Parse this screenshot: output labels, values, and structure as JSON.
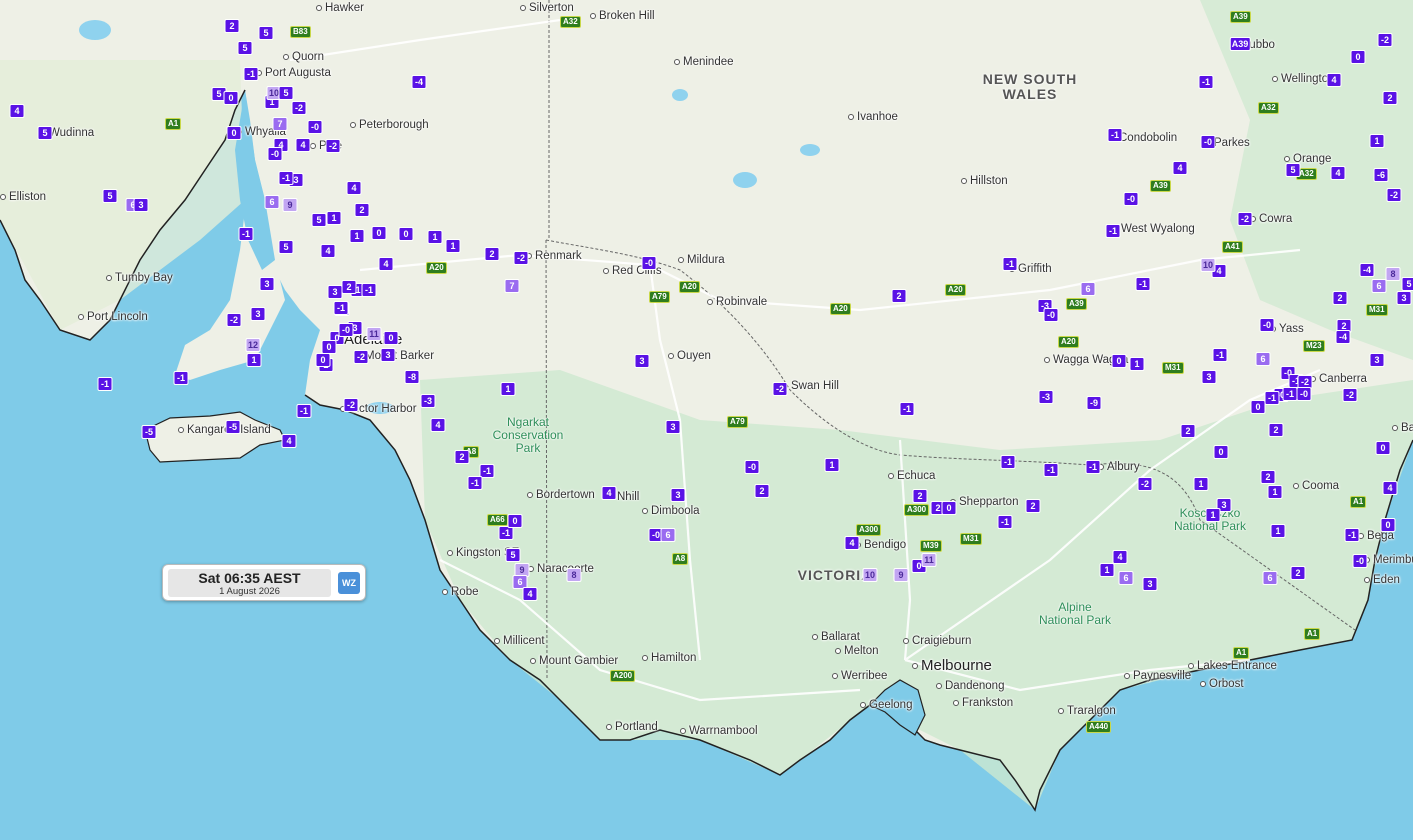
{
  "regions": [
    {
      "id": "nsw",
      "text": "NEW SOUTH\nWALES"
    },
    {
      "id": "vic",
      "text": "VICTORIA"
    }
  ],
  "parks": [
    {
      "id": "ngarkat",
      "text": "Ngarkat\nConservation\nPark"
    },
    {
      "id": "alpine",
      "text": "Alpine\nNational Park"
    },
    {
      "id": "kosciuszko",
      "text": "Kosciuszko\nNational Park"
    }
  ],
  "places": [
    "Hawker",
    "Silverton",
    "Broken Hill",
    "Quorn",
    "Port Augusta",
    "Menindee",
    "Dubbo",
    "Wellington",
    "Wudinna",
    "Whyalla",
    "Ivanhoe",
    "Peterborough",
    "Pirie",
    "Condobolin",
    "Parkes",
    "Orange",
    "Hillston",
    "Elliston",
    "West Wyalong",
    "Cowra",
    "Renmark",
    "Mildura",
    "Red Cliffs",
    "Griffith",
    "Tumby Bay",
    "Robinvale",
    "Port Lincoln",
    "Adelaide",
    "Mount Barker",
    "Ouyen",
    "Wagga Wagga",
    "Yass",
    "Canberra",
    "Swan Hill",
    "Victor Harbor",
    "Kangaroo Island",
    "Echuca",
    "Albury",
    "Bordertown",
    "Nhill",
    "Cooma",
    "Dimboola",
    "Shepparton",
    "Kingston SE",
    "Bendigo",
    "Bega",
    "Merimbula",
    "Naracoorte",
    "Robe",
    "Eden",
    "Ballarat",
    "Craigieburn",
    "Millicent",
    "Mount Gambier",
    "Melton",
    "Hamilton",
    "Melbourne",
    "Werribee",
    "Dandenong",
    "Paynesville",
    "Lakes Entrance",
    "Geelong",
    "Frankston",
    "Traralgon",
    "Portland",
    "Warrnambool",
    "Batemans Bay",
    "Orbost"
  ],
  "roads": [
    "A32",
    "B83",
    "A1",
    "A39",
    "A32",
    "A32",
    "A39",
    "A41",
    "A20",
    "A79",
    "A20",
    "A20",
    "A20",
    "A39",
    "A20",
    "M31",
    "M23",
    "M31",
    "A79",
    "A8",
    "A66",
    "A300",
    "M39",
    "M31",
    "A300",
    "A8",
    "A200",
    "A440",
    "A1",
    "A1",
    "A1"
  ],
  "observations": [
    "2",
    "5",
    "5",
    "A39",
    "-2",
    "-1",
    "5",
    "0",
    "-4",
    "-0",
    "-1",
    "2",
    "5",
    "0",
    "4",
    "1",
    "10",
    "5",
    "-2",
    "4",
    "5",
    "-0",
    "0",
    "4",
    "7",
    "-0",
    "4",
    "-2",
    "-1",
    "-0",
    "5",
    "1",
    "4",
    "4",
    "4",
    "-6",
    "3",
    "-1",
    "-2",
    "6",
    "3",
    "-0",
    "6",
    "5",
    "9",
    "5",
    "1",
    "1",
    "2",
    "-1",
    "1",
    "0",
    "0",
    "1",
    "2",
    "-1",
    "5",
    "-2",
    "4",
    "4",
    "-2",
    "-0",
    "6",
    "3",
    "4",
    "-4",
    "1",
    "8",
    "5",
    "7",
    "3",
    "-1",
    "2",
    "-1",
    "6",
    "3",
    "2",
    "-1",
    "-3",
    "-0",
    "2",
    "10",
    "-0",
    "2",
    "-4",
    "-3",
    "-2",
    "3",
    "0",
    "-1",
    "3",
    "12",
    "-0",
    "-1",
    "11",
    "0",
    "-2",
    "3",
    "0",
    "6",
    "3",
    "1",
    "2",
    "0",
    "-0",
    "-1",
    "-2",
    "-0",
    "3",
    "1",
    "0",
    "3",
    "-1",
    "-1",
    "-1",
    "-0",
    "-1",
    "0",
    "-8",
    "-9",
    "-1",
    "-3",
    "-2",
    "-3",
    "-1",
    "-2",
    "-2",
    "1",
    "-5",
    "-5",
    "4",
    "4",
    "3",
    "2",
    "2",
    "2",
    "-1",
    "0",
    "0",
    "-0",
    "1",
    "-1",
    "-1",
    "-1",
    "2",
    "4",
    "-2",
    "1",
    "1",
    "-1",
    "2",
    "3",
    "4",
    "2",
    "2",
    "0",
    "2",
    "-1",
    "3",
    "1",
    "-1",
    "0",
    "1",
    "-1",
    "-0",
    "6",
    "4",
    "0",
    "-0",
    "5",
    "4",
    "1",
    "6",
    "3",
    "6",
    "2",
    "8",
    "9",
    "9",
    "0",
    "11",
    "10",
    "6",
    "4"
  ],
  "timestamp": {
    "main": "Sat 06:35 AEST",
    "date": "1 August 2026",
    "logo": "WZ"
  }
}
